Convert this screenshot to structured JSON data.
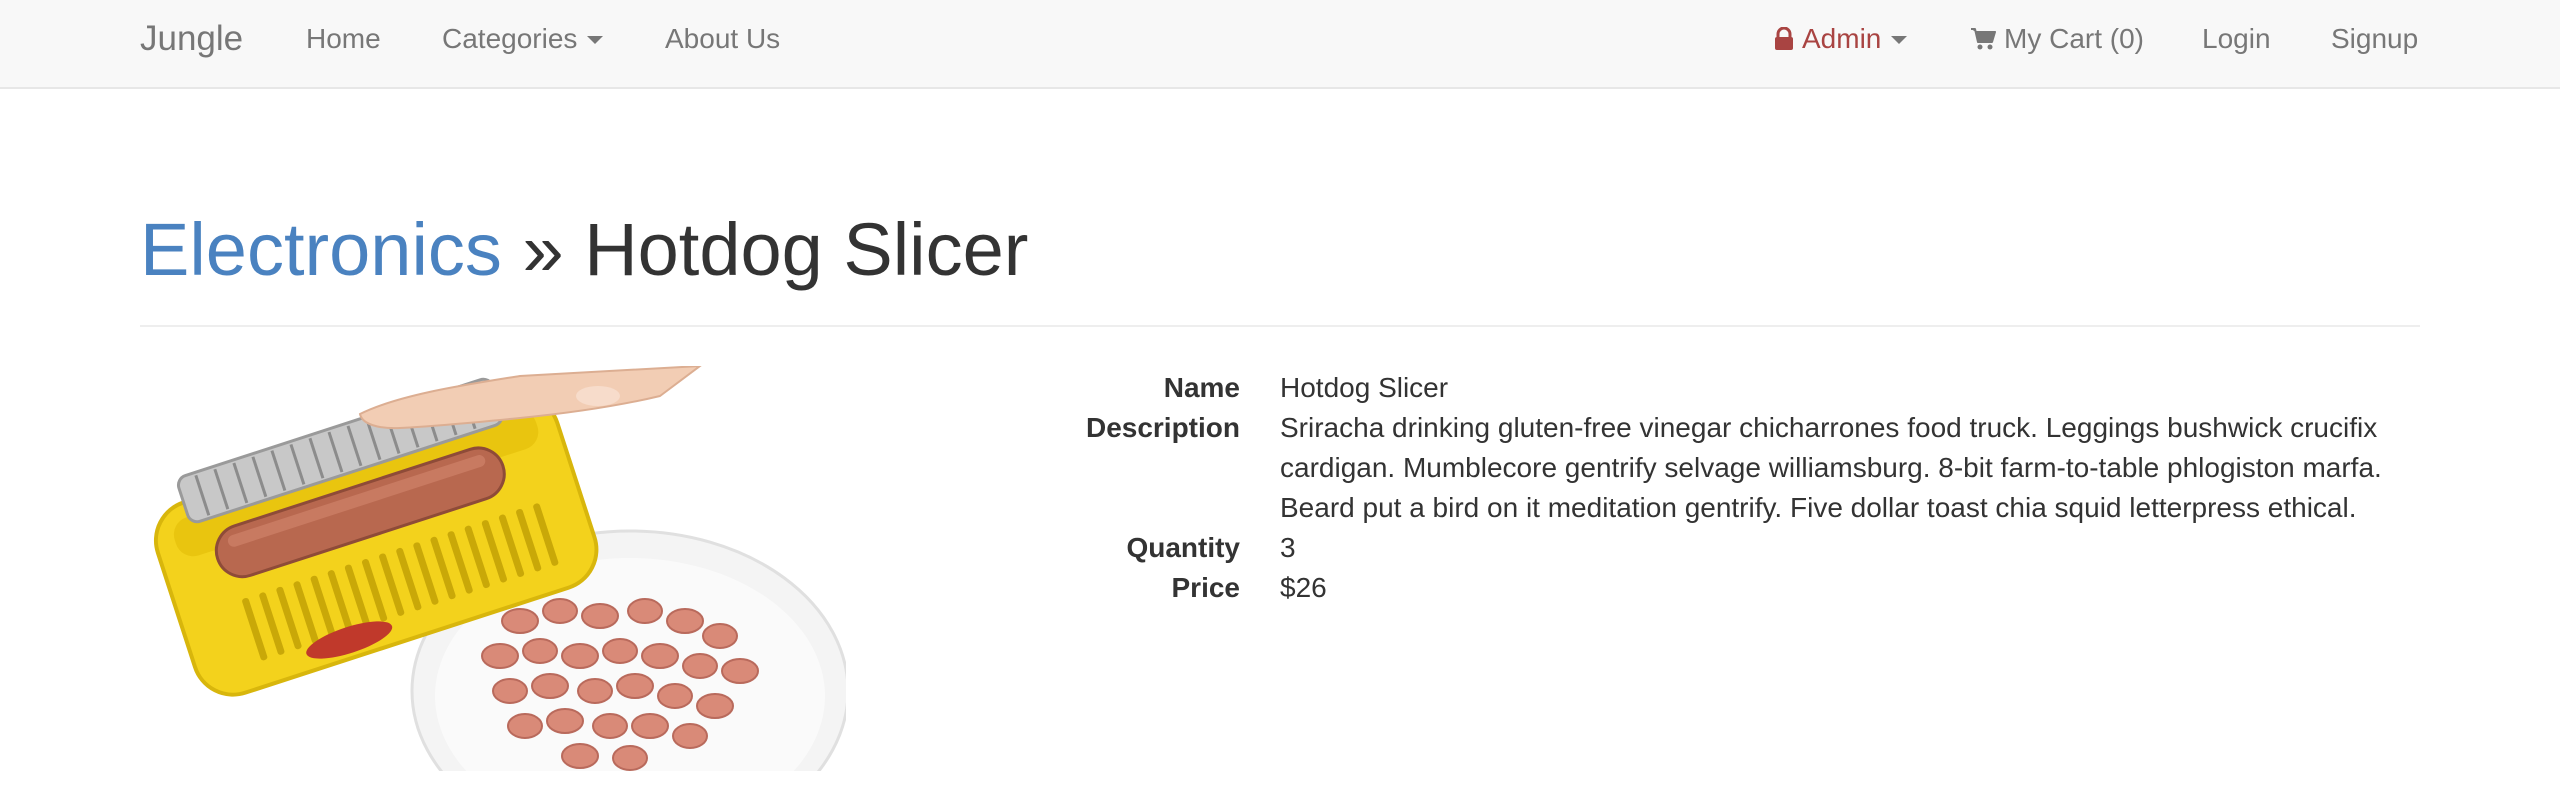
{
  "nav": {
    "brand": "Jungle",
    "home": "Home",
    "categories": "Categories",
    "about": "About Us",
    "admin": "Admin",
    "cart": "My Cart (0)",
    "login": "Login",
    "signup": "Signup",
    "icons": {
      "admin": "lock-icon",
      "cart": "cart-icon"
    },
    "colors": {
      "admin": "#a94442",
      "link": "#777777"
    }
  },
  "breadcrumb": {
    "category": "Electronics",
    "separator": "»",
    "product": "Hotdog Slicer"
  },
  "product": {
    "image_alt": "Hotdog slicer with sliced hot dogs on a plate",
    "name_label": "Name",
    "name": "Hotdog Slicer",
    "description_label": "Description",
    "description": "Sriracha drinking gluten-free vinegar chicharrones food truck. Leggings bushwick crucifix cardigan. Mumblecore gentrify selvage williamsburg. 8-bit farm-to-table phlogiston marfa. Beard put a bird on it meditation gentrify. Five dollar toast chia squid letterpress ethical.",
    "quantity_label": "Quantity",
    "quantity": "3",
    "price_label": "Price",
    "price": "$26"
  },
  "colors": {
    "category_link": "#4a82c0",
    "text": "#333333"
  }
}
